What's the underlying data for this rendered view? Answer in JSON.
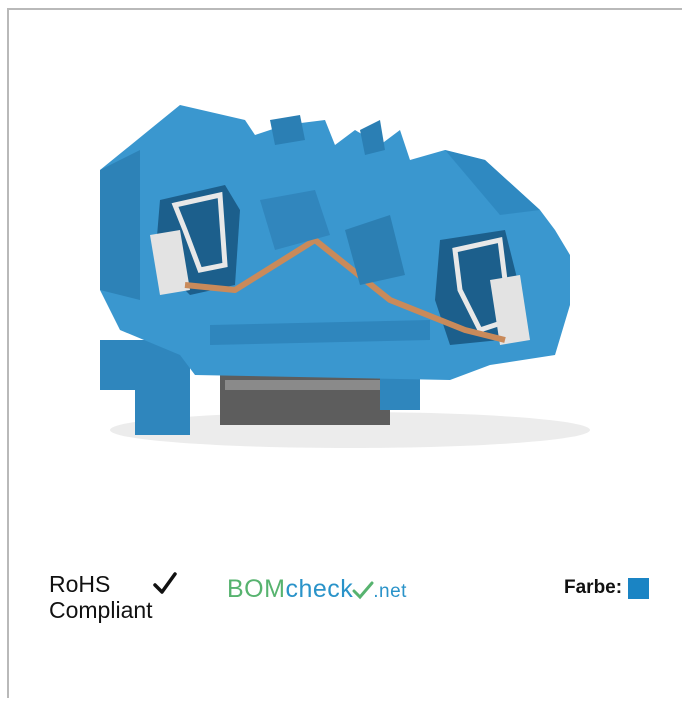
{
  "certifications": {
    "rohs_line1": "RoHS",
    "rohs_line2": "Compliant",
    "check_icon": "checkmark-icon"
  },
  "bomcheck_logo": {
    "part1": "BOM",
    "part2": "check",
    "part3": ".net"
  },
  "color_info": {
    "label": "Farbe:",
    "swatch_color": "#1a84c4"
  },
  "product": {
    "body_color": "#3a97cf"
  }
}
